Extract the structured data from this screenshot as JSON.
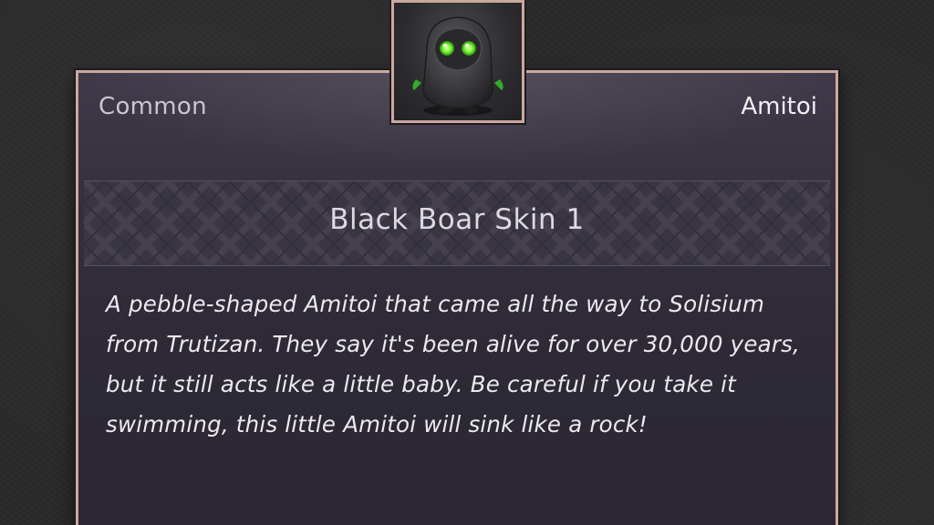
{
  "item": {
    "rarity": "Common",
    "category": "Amitoi",
    "name": "Black Boar Skin 1",
    "description": "A pebble-shaped Amitoi that came all the way to Solisium from Trutizan. They say it's been alive for over 30,000 years, but it still acts like a little baby. Be careful if you take it swimming, this little Amitoi will sink like a rock!",
    "portrait_icon": "amitoi-pebble-creature-icon"
  },
  "colors": {
    "frame_border": "#caa89e",
    "card_background": "#2d2a35",
    "page_background": "#2a2a2a",
    "eye_glow": "#7cff3a"
  }
}
